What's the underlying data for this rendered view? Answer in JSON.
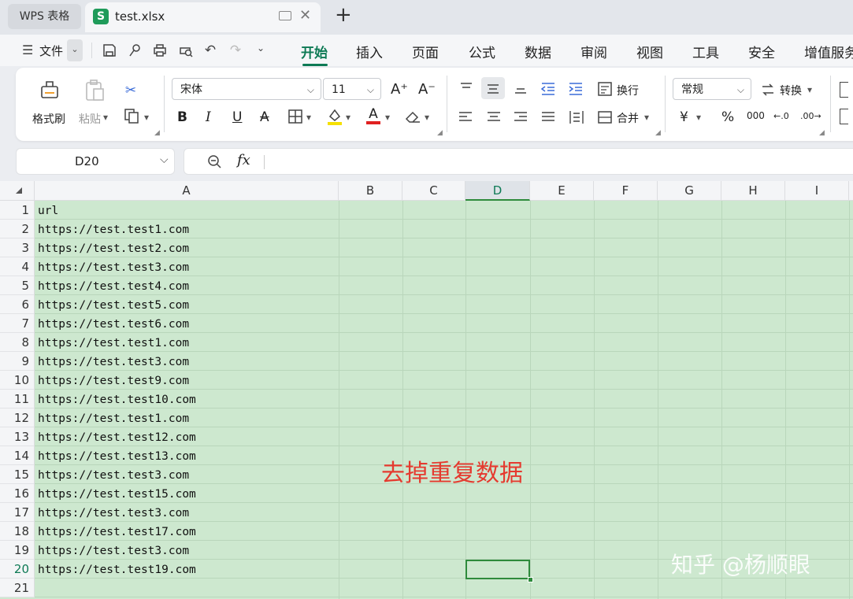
{
  "tabs": {
    "app_label": "WPS 表格",
    "file_icon_letter": "S",
    "file_name": "test.xlsx",
    "close_glyph": "✕",
    "new_tab_glyph": "+"
  },
  "menu": {
    "file_label": "文件",
    "nav": [
      "开始",
      "插入",
      "页面",
      "公式",
      "数据",
      "审阅",
      "视图",
      "工具",
      "安全",
      "增值服务"
    ],
    "active_nav": "开始"
  },
  "ribbon": {
    "format_painter": "格式刷",
    "paste": "粘贴",
    "font_name": "宋体",
    "font_size": "11",
    "wrap": "换行",
    "merge": "合并",
    "number_format": "常规",
    "convert": "转换",
    "bold": "B",
    "italic": "I",
    "underline": "U",
    "strike": "A",
    "font_color_letter": "A",
    "font_color": "#e02020",
    "fill_color": "#f5e000",
    "currency": "¥",
    "percent": "%",
    "thousands": "000",
    "inc_decimal": "←.0",
    "dec_decimal": ".00→",
    "font_grow": "A⁺",
    "font_shrink": "A⁻"
  },
  "formula_bar": {
    "cell_ref": "D20",
    "fx": "fx"
  },
  "sheet": {
    "columns": [
      "A",
      "B",
      "C",
      "D",
      "E",
      "F",
      "G",
      "H",
      "I"
    ],
    "selected_column": "D",
    "row_numbers": [
      "1",
      "2",
      "3",
      "4",
      "5",
      "6",
      "7",
      "8",
      "9",
      "10",
      "11",
      "12",
      "13",
      "14",
      "15",
      "16",
      "17",
      "18",
      "19",
      "20",
      "21"
    ],
    "selected_row": "20",
    "colA": [
      "url",
      "https://test.test1.com",
      "https://test.test2.com",
      "https://test.test3.com",
      "https://test.test4.com",
      "https://test.test5.com",
      "https://test.test6.com",
      "https://test.test1.com",
      "https://test.test3.com",
      "https://test.test9.com",
      "https://test.test10.com",
      "https://test.test1.com",
      "https://test.test12.com",
      "https://test.test13.com",
      "https://test.test3.com",
      "https://test.test15.com",
      "https://test.test3.com",
      "https://test.test17.com",
      "https://test.test3.com",
      "https://test.test19.com",
      ""
    ],
    "annotation": "去掉重复数据",
    "annotation_color": "#e53a2f",
    "watermark": "知乎 @杨顺眼",
    "sheet_fill_color": "#cde8cf"
  }
}
